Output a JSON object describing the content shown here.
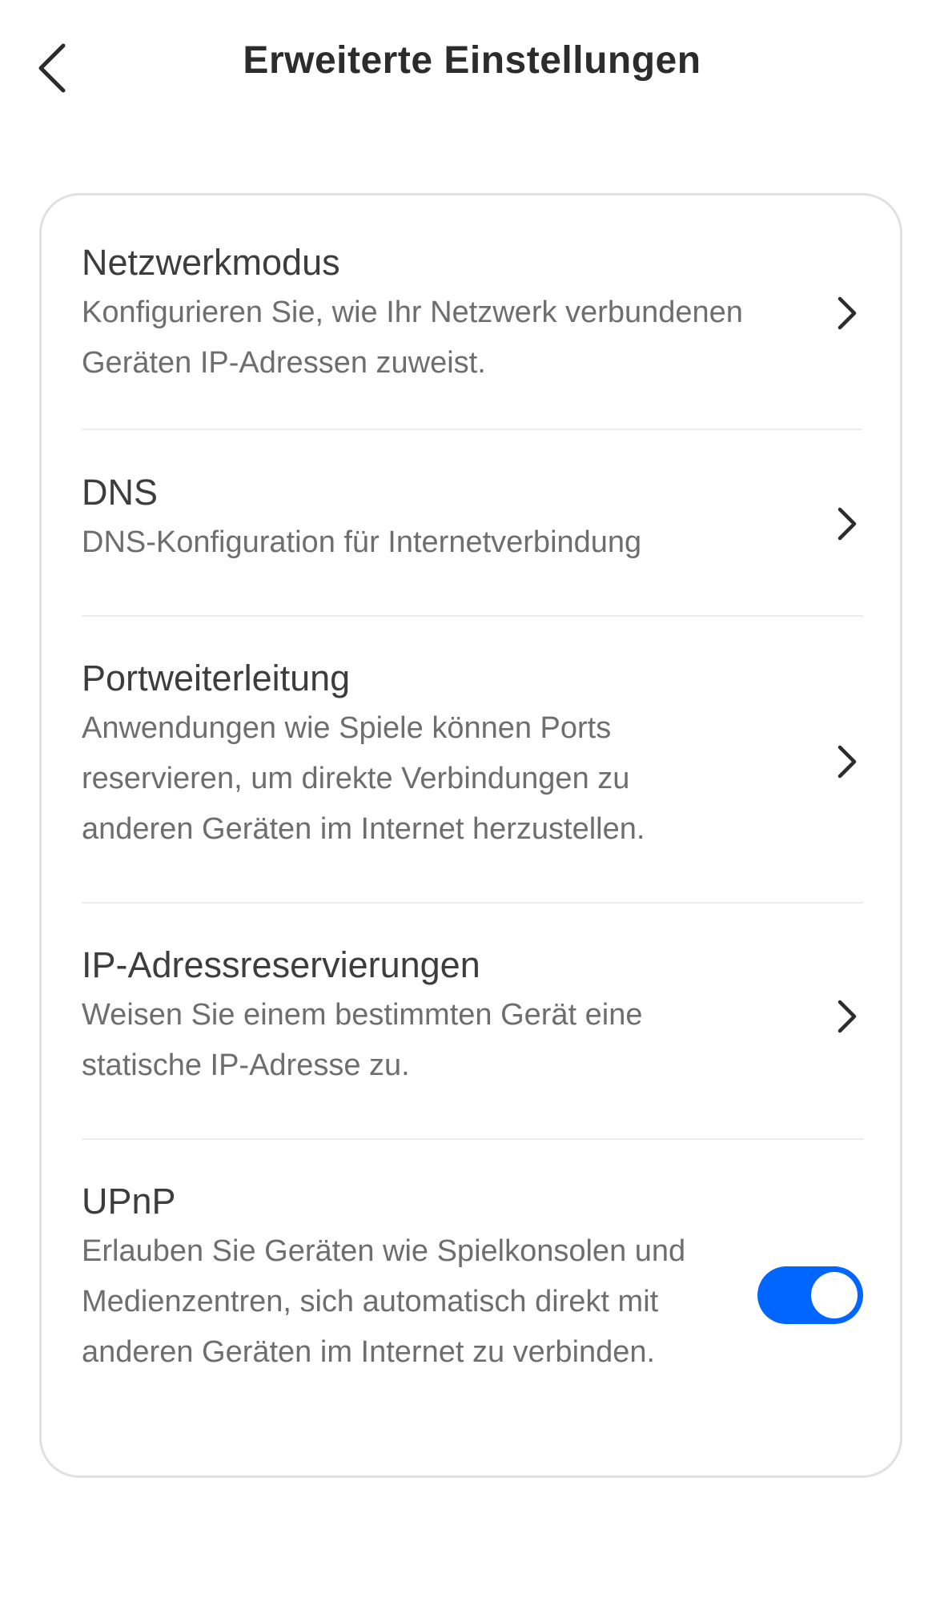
{
  "header": {
    "title": "Erweiterte Einstellungen",
    "back_icon": "chevron-left-icon"
  },
  "settings": [
    {
      "title": "Netzwerkmodus",
      "description": "Konfigurieren Sie, wie Ihr Netzwerk verbundenen Geräten IP-Adressen zuweist.",
      "control": "chevron-right-icon"
    },
    {
      "title": "DNS",
      "description": "DNS-Konfiguration für Internetverbindung",
      "control": "chevron-right-icon"
    },
    {
      "title": "Portweiterleitung",
      "description": "Anwendungen wie Spiele können Ports reservieren, um direkte Verbindungen zu anderen Geräten im Internet herzustellen.",
      "control": "chevron-right-icon"
    },
    {
      "title": "IP-Adressreservierungen",
      "description": "Weisen Sie einem bestimmten Gerät eine statische IP-Adresse zu.",
      "control": "chevron-right-icon"
    },
    {
      "title": "UPnP",
      "description": "Erlauben Sie Geräten wie Spielkonsolen und Medienzentren, sich automatisch direkt mit anderen Geräten im Internet zu verbinden.",
      "control": "toggle",
      "enabled": true
    }
  ],
  "colors": {
    "accent": "#0066ff",
    "title_text": "#2c2c2c",
    "description_text": "#6e6e6e",
    "card_border": "#e1e1e1"
  }
}
